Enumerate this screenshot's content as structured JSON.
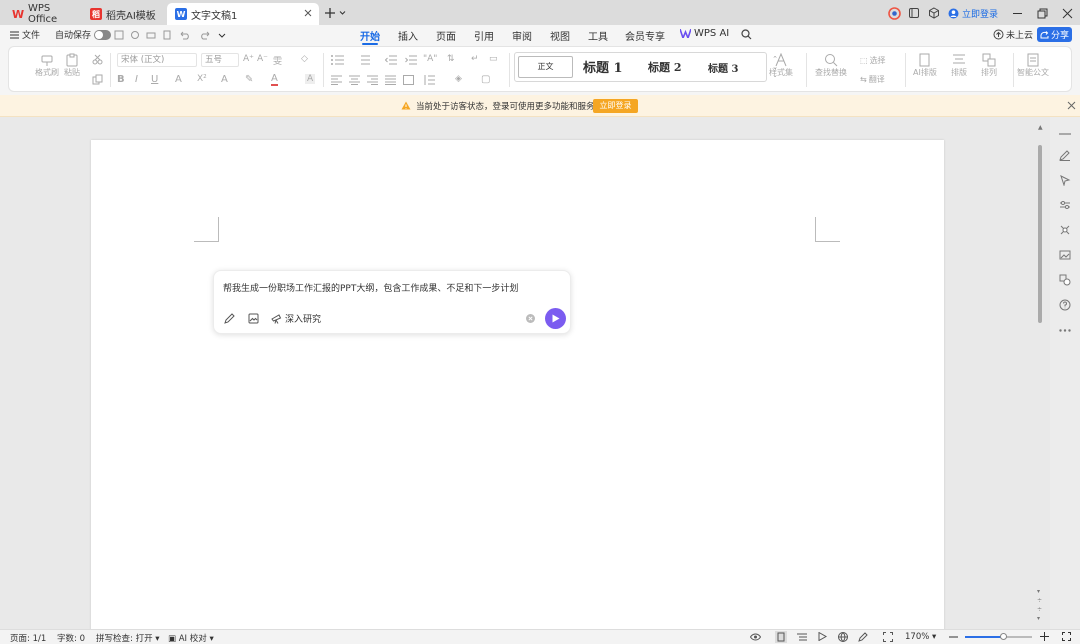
{
  "tabs": [
    {
      "label": "WPS Office",
      "icon": "wps-logo-icon",
      "color": "#e8342f"
    },
    {
      "label": "稻壳AI模板",
      "icon": "docer-logo-icon",
      "color": "#e8342f"
    },
    {
      "label": "文字文稿1",
      "icon": "word-doc-icon",
      "color": "#2b6fe6"
    }
  ],
  "titlebar": {
    "login_label": "立即登录"
  },
  "menu": {
    "file_label": "文件",
    "autosave_label": "自动保存",
    "tabs": [
      "开始",
      "插入",
      "页面",
      "引用",
      "审阅",
      "视图",
      "工具",
      "会员专享",
      "WPS AI"
    ],
    "active_tab": "开始",
    "cloud_label": "未上云",
    "share_label": "分享"
  },
  "ribbon": {
    "format_painter": "格式刷",
    "paste": "粘贴",
    "font_name": "宋体 (正文)",
    "font_size": "五号",
    "styles": {
      "normal": "正文",
      "h1": "标题 1",
      "h2": "标题 2",
      "h3": "标题 3"
    },
    "style_set": "样式集",
    "find_replace": "查找替换",
    "select": "选择",
    "translate": "翻译",
    "ai_layout": "AI排版",
    "layout": "排版",
    "sort": "排列",
    "smart_doc": "智能公文"
  },
  "notify": {
    "text": "当前处于访客状态，登录可使用更多功能和服务",
    "button": "立即登录"
  },
  "prompt": {
    "text": "帮我生成一份职场工作汇报的PPT大纲，包含工作成果、不足和下一步计划",
    "deep_research": "深入研究"
  },
  "status": {
    "page": "页面: 1/1",
    "words": "字数: 0",
    "spell": "拼写检查: 打开",
    "ai_check": "AI 校对",
    "zoom": "170%"
  },
  "colors": {
    "accent": "#1a6be5",
    "notify_btn": "#f5a623",
    "send_btn": "#7b5cf0"
  }
}
